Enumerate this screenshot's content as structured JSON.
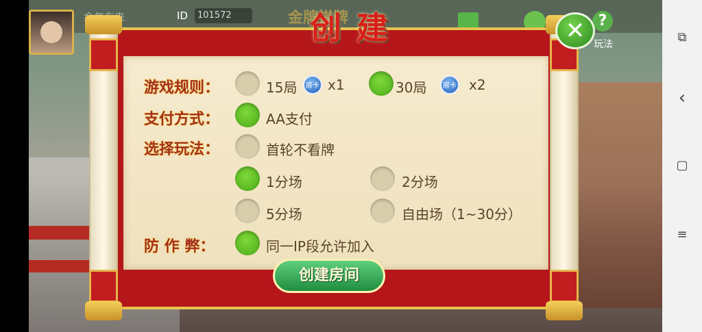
{
  "player": {
    "name": "金气东来",
    "id_label": "ID",
    "id_value": "101572"
  },
  "top_icons": {
    "help_label": "玩法"
  },
  "dialog": {
    "title": "创建",
    "title_bg": "金牌棋牌",
    "rules_label": "游戏规则：",
    "rules_options": [
      {
        "label": "15局",
        "card": "房卡",
        "mult": "x1",
        "selected": false
      },
      {
        "label": "30局",
        "card": "房卡",
        "mult": "x2",
        "selected": true
      }
    ],
    "payment_label": "支付方式：",
    "payment_option": {
      "label": "AA支付",
      "selected": true
    },
    "mode_label": "选择玩法：",
    "mode_option": {
      "label": "首轮不看牌",
      "selected": false
    },
    "score_options": [
      {
        "label": "1分场",
        "selected": true
      },
      {
        "label": "2分场",
        "selected": false
      },
      {
        "label": "5分场",
        "selected": false
      },
      {
        "label": "自由场（1~30分）",
        "selected": false
      }
    ],
    "anticheat_label": "防 作 弊：",
    "anticheat_option": {
      "label": "同一IP段允许加入",
      "selected": true
    },
    "create_button": "创建房间",
    "close": "✕"
  },
  "navbar": {
    "recent": "⧉",
    "back": "‹",
    "home": "▢",
    "menu": "≡"
  }
}
